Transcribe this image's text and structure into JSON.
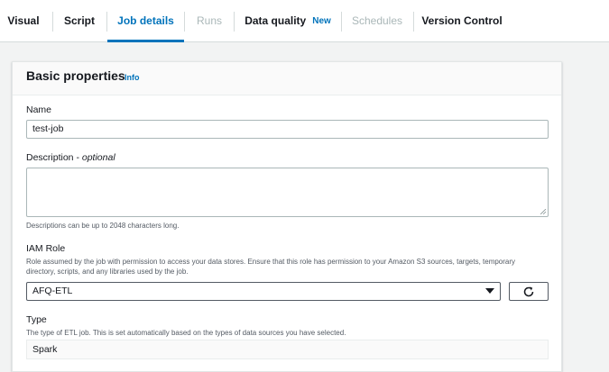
{
  "tabs": [
    {
      "label": "Visual",
      "state": "normal"
    },
    {
      "label": "Script",
      "state": "normal"
    },
    {
      "label": "Job details",
      "state": "active"
    },
    {
      "label": "Runs",
      "state": "disabled"
    },
    {
      "label": "Data quality",
      "state": "normal",
      "badge": "New"
    },
    {
      "label": "Schedules",
      "state": "disabled"
    },
    {
      "label": "Version Control",
      "state": "normal"
    }
  ],
  "section": {
    "title": "Basic properties",
    "info_label": "Info"
  },
  "fields": {
    "name": {
      "label": "Name",
      "value": "test-job"
    },
    "description": {
      "label": "Description",
      "label_suffix": "optional",
      "separator": " - ",
      "value": "",
      "hint": "Descriptions can be up to 2048 characters long."
    },
    "iam_role": {
      "label": "IAM Role",
      "hint": "Role assumed by the job with permission to access your data stores. Ensure that this role has permission to your Amazon S3 sources, targets, temporary directory, scripts, and any libraries used by the job.",
      "value": "AFQ-ETL"
    },
    "type": {
      "label": "Type",
      "hint": "The type of ETL job. This is set automatically based on the types of data sources you have selected.",
      "value": "Spark"
    }
  },
  "icons": {
    "refresh": "refresh-icon",
    "dropdown": "caret-down-icon",
    "resize": "resize-handle-icon"
  },
  "colors": {
    "accent": "#0073bb",
    "disabled": "#aab7b8",
    "text": "#16191f",
    "muted": "#545b64"
  }
}
